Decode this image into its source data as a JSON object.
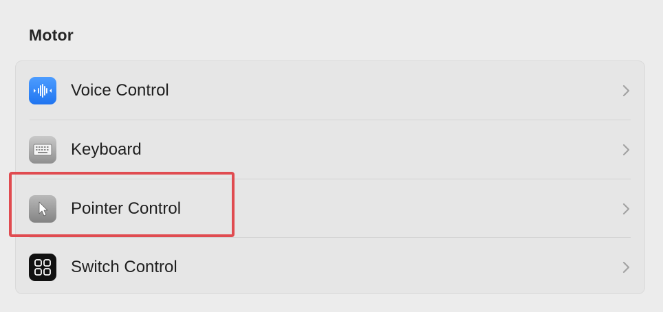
{
  "section": {
    "title": "Motor"
  },
  "items": [
    {
      "label": "Voice Control",
      "icon": "voice-control-icon",
      "icon_color": "#1f74f0"
    },
    {
      "label": "Keyboard",
      "icon": "keyboard-icon",
      "icon_color": "#a8a8a8"
    },
    {
      "label": "Pointer Control",
      "icon": "pointer-icon",
      "icon_color": "#9a9a9a"
    },
    {
      "label": "Switch Control",
      "icon": "switch-control-icon",
      "icon_color": "#111111"
    }
  ],
  "annotation": {
    "highlight_color": "#e04b50",
    "highlighted_item": "Pointer Control"
  }
}
